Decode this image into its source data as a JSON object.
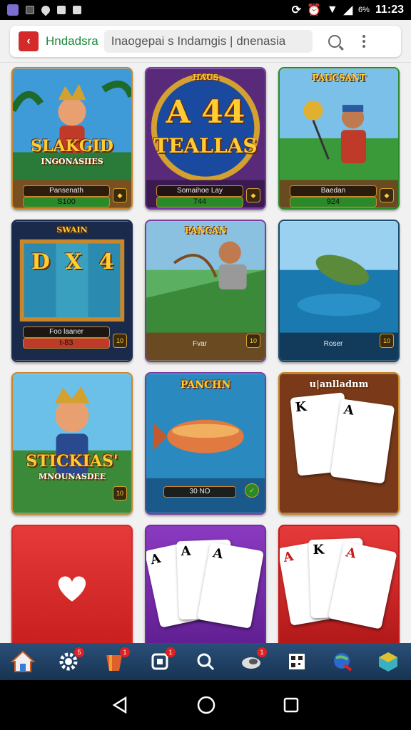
{
  "status_bar": {
    "time": "11:23",
    "battery_text": "6%",
    "left_icons": [
      "gallery-icon",
      "notification-icon",
      "location-icon",
      "app-icon",
      "photo-icon"
    ],
    "right_icons": [
      "sync-icon",
      "alarm-icon",
      "wifi-icon",
      "signal-icon"
    ]
  },
  "browser": {
    "site_name": "Hndadsra",
    "url": "Inaogepai s Indamgis | dnenasia",
    "site_icon_glyph": "‹"
  },
  "tiles": [
    {
      "title": "SLAKGID",
      "subtitle": "INGONASIIES",
      "label": "Pansenath",
      "value": "S100"
    },
    {
      "header": "HAUS",
      "title": "A 44",
      "subtitle": "TEALLAS",
      "label": "Somaihoe Lay",
      "value": "744"
    },
    {
      "header": "PAUCSANT",
      "label": "Baedan",
      "value": "924"
    },
    {
      "header": "SWAIN",
      "reels": [
        "D",
        "X",
        "4"
      ],
      "label": "Foo laaner",
      "value": "t-83",
      "badge": "10"
    },
    {
      "header": "PANCAN",
      "label": "Fvar",
      "badge": "10"
    },
    {
      "label": "Roser",
      "badge": "10"
    },
    {
      "title": "STICKIAS'",
      "subtitle": "MNOUNASDEE",
      "badge": "10"
    },
    {
      "header": "PANCHN",
      "value": "30 NO"
    },
    {
      "header": "u|anlladnm",
      "cards": [
        "K",
        "A"
      ]
    },
    {
      "icon": "heart-icon"
    },
    {
      "cards": [
        "A",
        "A",
        "A"
      ]
    },
    {
      "cards": [
        "A",
        "K",
        "A"
      ]
    }
  ],
  "bottom_nav": [
    {
      "icon": "home-icon"
    },
    {
      "icon": "gear-icon",
      "badge": "5"
    },
    {
      "icon": "treasure-icon",
      "badge": "1"
    },
    {
      "icon": "chat-icon",
      "badge": "1"
    },
    {
      "icon": "search-icon"
    },
    {
      "icon": "shoe-icon",
      "badge": "1"
    },
    {
      "icon": "qr-icon"
    },
    {
      "icon": "globe-icon"
    },
    {
      "icon": "cube-icon"
    }
  ],
  "system_nav": [
    "back-icon",
    "home-circle-icon",
    "recents-icon"
  ],
  "colors": {
    "accent": "#1a8a3a",
    "nav_bg": "#1f4066",
    "frame": "#c8872a"
  }
}
